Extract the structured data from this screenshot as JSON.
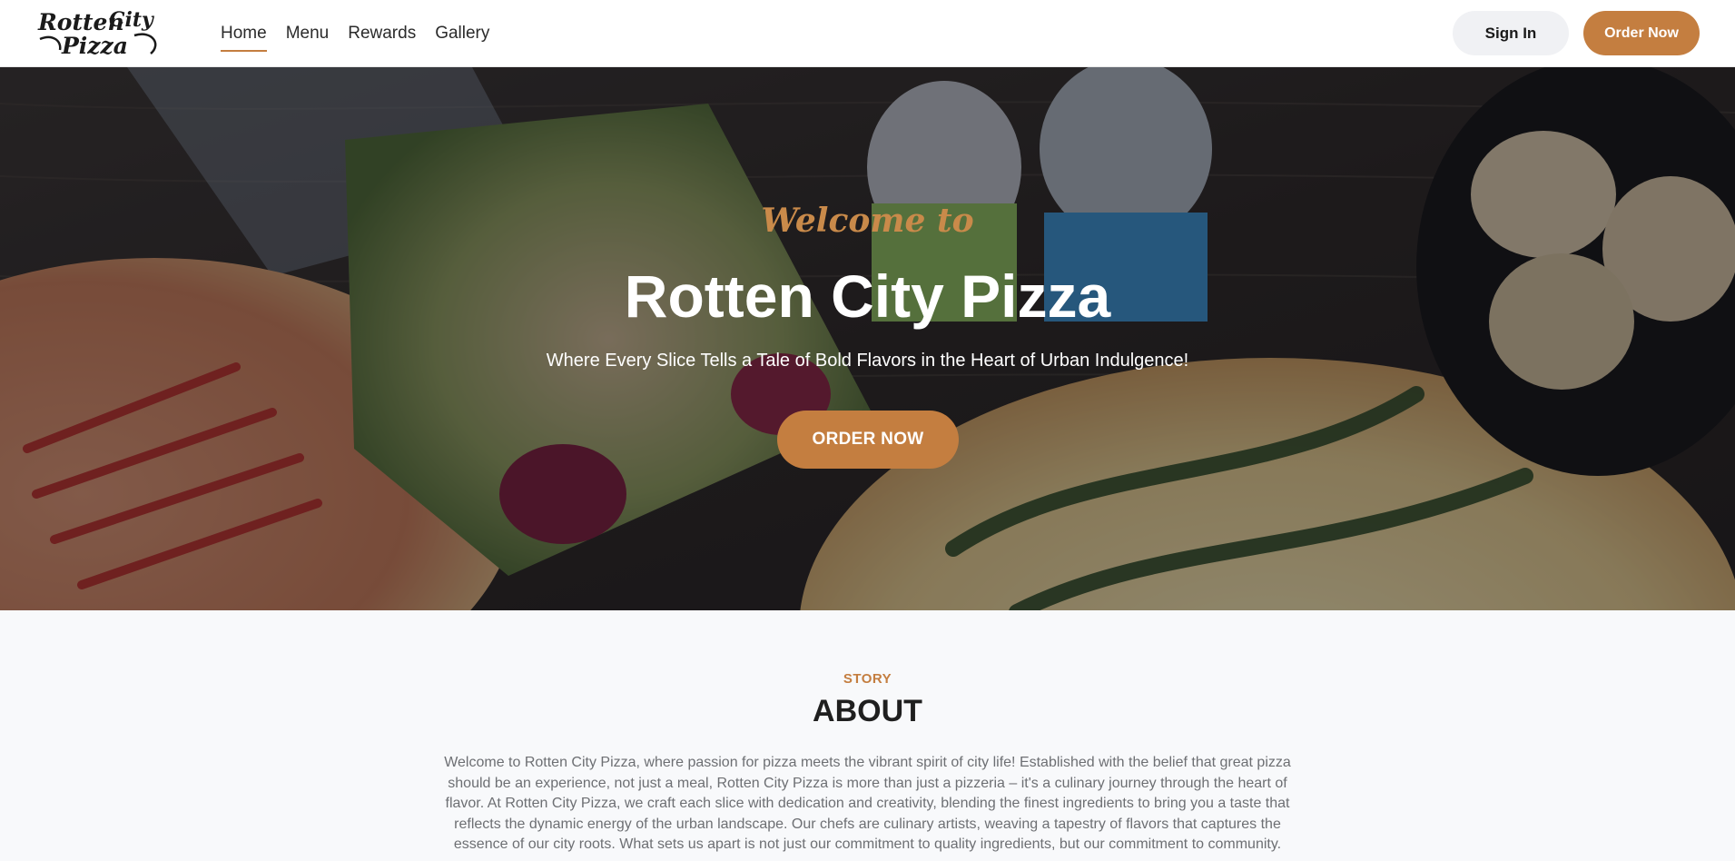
{
  "nav": {
    "brand": "Rotten City Pizza",
    "items": [
      {
        "label": "Home",
        "active": true
      },
      {
        "label": "Menu",
        "active": false
      },
      {
        "label": "Rewards",
        "active": false
      },
      {
        "label": "Gallery",
        "active": false
      }
    ],
    "sign_in_label": "Sign In",
    "order_label": "Order Now"
  },
  "hero": {
    "welcome": "Welcome to",
    "title": "Rotten City Pizza",
    "subtitle": "Where Every Slice Tells a Tale of Bold Flavors in the Heart of Urban Indulgence!",
    "cta_label": "ORDER NOW"
  },
  "about": {
    "eyebrow": "STORY",
    "title": "ABOUT",
    "body": "Welcome to Rotten City Pizza, where passion for pizza meets the vibrant spirit of city life! Established with the belief that great pizza should be an experience, not just a meal, Rotten City Pizza is more than just a pizzeria – it's a culinary journey through the heart of flavor. At Rotten City Pizza, we craft each slice with dedication and creativity, blending the finest ingredients to bring you a taste that reflects the dynamic energy of the urban landscape. Our chefs are culinary artists, weaving a tapestry of flavors that captures the essence of our city roots. What sets us apart is not just our commitment to quality ingredients, but our commitment to community."
  },
  "colors": {
    "accent": "#c47e40",
    "nav_bg": "#ffffff",
    "page_bg": "#f8f9fb",
    "body_text": "#6d6f73"
  }
}
